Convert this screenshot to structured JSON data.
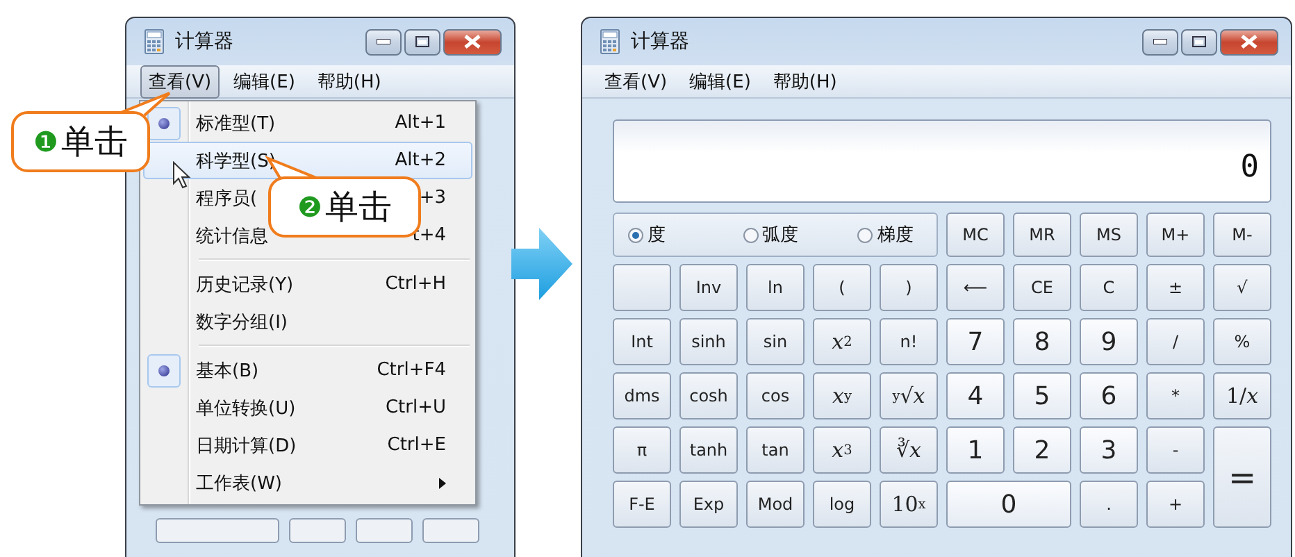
{
  "left_window": {
    "title": "计算器",
    "menu_bar": [
      {
        "label": "查看(V)",
        "selected": true
      },
      {
        "label": "编辑(E)",
        "selected": false
      },
      {
        "label": "帮助(H)",
        "selected": false
      }
    ],
    "view_menu": {
      "groups": [
        [
          {
            "label": "标准型(T)",
            "shortcut": "Alt+1",
            "checked": true,
            "highlighted": false,
            "submenu": false
          },
          {
            "label": "科学型(S)",
            "shortcut": "Alt+2",
            "checked": false,
            "highlighted": true,
            "submenu": false
          },
          {
            "label": "程序员(",
            "shortcut": "+3",
            "checked": false,
            "highlighted": false,
            "submenu": false
          },
          {
            "label": "统计信息",
            "shortcut": "t+4",
            "checked": false,
            "highlighted": false,
            "submenu": false
          }
        ],
        [
          {
            "label": "历史记录(Y)",
            "shortcut": "Ctrl+H",
            "checked": false,
            "highlighted": false,
            "submenu": false
          },
          {
            "label": "数字分组(I)",
            "checked": false,
            "highlighted": false,
            "submenu": false
          }
        ],
        [
          {
            "label": "基本(B)",
            "shortcut": "Ctrl+F4",
            "checked": true,
            "highlighted": false,
            "submenu": false
          },
          {
            "label": "单位转换(U)",
            "shortcut": "Ctrl+U",
            "checked": false,
            "highlighted": false,
            "submenu": false
          },
          {
            "label": "日期计算(D)",
            "shortcut": "Ctrl+E",
            "checked": false,
            "highlighted": false,
            "submenu": false
          },
          {
            "label": "工作表(W)",
            "checked": false,
            "highlighted": false,
            "submenu": true
          }
        ]
      ]
    }
  },
  "callouts": [
    {
      "number": "❶",
      "text": "单击"
    },
    {
      "number": "❷",
      "text": "单击"
    }
  ],
  "right_window": {
    "title": "计算器",
    "menu_bar": [
      {
        "label": "查看(V)",
        "selected": false
      },
      {
        "label": "编辑(E)",
        "selected": false
      },
      {
        "label": "帮助(H)",
        "selected": false
      }
    ],
    "display": "0",
    "angle_units": [
      {
        "label": "度",
        "selected": true
      },
      {
        "label": "弧度",
        "selected": false
      },
      {
        "label": "梯度",
        "selected": false
      }
    ],
    "keys": [
      {
        "label": "MC",
        "kind": "key"
      },
      {
        "label": "MR",
        "kind": "key"
      },
      {
        "label": "MS",
        "kind": "key"
      },
      {
        "label": "M+",
        "kind": "key"
      },
      {
        "label": "M-",
        "kind": "key"
      },
      {
        "kind": "blank"
      },
      {
        "label": "Inv",
        "kind": "key"
      },
      {
        "label": "ln",
        "kind": "key"
      },
      {
        "label": "(",
        "kind": "key"
      },
      {
        "label": ")",
        "kind": "key"
      },
      {
        "label": "⟵",
        "kind": "key"
      },
      {
        "label": "CE",
        "kind": "key"
      },
      {
        "label": "C",
        "kind": "key"
      },
      {
        "label": "±",
        "kind": "key"
      },
      {
        "label": "√",
        "kind": "key"
      },
      {
        "label": "Int",
        "kind": "key"
      },
      {
        "label": "sinh",
        "kind": "key"
      },
      {
        "label": "sin",
        "kind": "key"
      },
      {
        "label": "*x*$^{2}$",
        "kind": "math"
      },
      {
        "label": "n!",
        "kind": "key"
      },
      {
        "label": "7",
        "kind": "digit"
      },
      {
        "label": "8",
        "kind": "digit"
      },
      {
        "label": "9",
        "kind": "digit"
      },
      {
        "label": "/",
        "kind": "key"
      },
      {
        "label": "%",
        "kind": "key"
      },
      {
        "label": "dms",
        "kind": "key"
      },
      {
        "label": "cosh",
        "kind": "key"
      },
      {
        "label": "cos",
        "kind": "key"
      },
      {
        "label": "*x*$^{y}$",
        "kind": "math"
      },
      {
        "label": "$^{y}$√*x*",
        "kind": "math"
      },
      {
        "label": "4",
        "kind": "digit"
      },
      {
        "label": "5",
        "kind": "digit"
      },
      {
        "label": "6",
        "kind": "digit"
      },
      {
        "label": "*",
        "kind": "key"
      },
      {
        "label": "1/*x*",
        "kind": "math"
      },
      {
        "label": "π",
        "kind": "key"
      },
      {
        "label": "tanh",
        "kind": "key"
      },
      {
        "label": "tan",
        "kind": "key"
      },
      {
        "label": "*x*$^{3}$",
        "kind": "math"
      },
      {
        "label": "∛*x*",
        "kind": "math"
      },
      {
        "label": "1",
        "kind": "digit"
      },
      {
        "label": "2",
        "kind": "digit"
      },
      {
        "label": "3",
        "kind": "digit"
      },
      {
        "label": "-",
        "kind": "key"
      },
      {
        "label": "=",
        "kind": "tall"
      },
      {
        "label": "F-E",
        "kind": "key"
      },
      {
        "label": "Exp",
        "kind": "key"
      },
      {
        "label": "Mod",
        "kind": "key"
      },
      {
        "label": "log",
        "kind": "key"
      },
      {
        "label": "10$^{x}$",
        "kind": "math"
      },
      {
        "label": "0",
        "kind": "wide"
      },
      {
        "label": ".",
        "kind": "key"
      },
      {
        "label": "+",
        "kind": "key"
      }
    ]
  }
}
